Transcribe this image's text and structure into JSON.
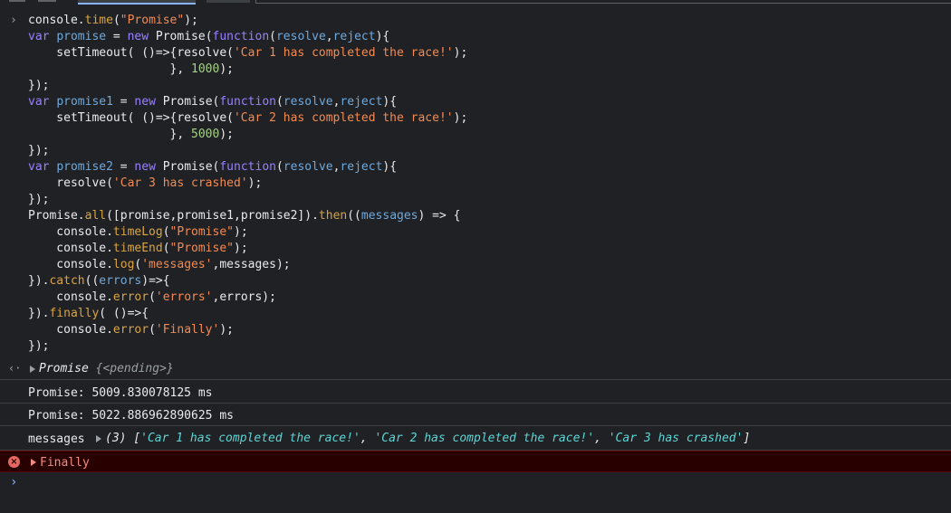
{
  "console": {
    "prompt_symbol": "›",
    "result_symbol": "‹·",
    "input_lines": [
      [
        [
          "default",
          "console."
        ],
        [
          "method",
          "time"
        ],
        [
          "default",
          "("
        ],
        [
          "string",
          "\"Promise\""
        ],
        [
          "default",
          ");"
        ]
      ],
      [
        [
          "keyword",
          "var "
        ],
        [
          "variable",
          "promise"
        ],
        [
          "default",
          " = "
        ],
        [
          "keyword",
          "new "
        ],
        [
          "default",
          "Promise("
        ],
        [
          "keyword",
          "function"
        ],
        [
          "default",
          "("
        ],
        [
          "param",
          "resolve"
        ],
        [
          "default",
          ","
        ],
        [
          "param",
          "reject"
        ],
        [
          "default",
          "){"
        ]
      ],
      [
        [
          "default",
          "    setTimeout( ()=>{resolve("
        ],
        [
          "string",
          "'Car 1 has completed the race!'"
        ],
        [
          "default",
          ");"
        ]
      ],
      [
        [
          "default",
          "                    }, "
        ],
        [
          "number",
          "1000"
        ],
        [
          "default",
          ");"
        ]
      ],
      [
        [
          "default",
          "});"
        ]
      ],
      [
        [
          "keyword",
          "var "
        ],
        [
          "variable",
          "promise1"
        ],
        [
          "default",
          " = "
        ],
        [
          "keyword",
          "new "
        ],
        [
          "default",
          "Promise("
        ],
        [
          "keyword",
          "function"
        ],
        [
          "default",
          "("
        ],
        [
          "param",
          "resolve"
        ],
        [
          "default",
          ","
        ],
        [
          "param",
          "reject"
        ],
        [
          "default",
          "){"
        ]
      ],
      [
        [
          "default",
          "    setTimeout( ()=>{resolve("
        ],
        [
          "string",
          "'Car 2 has completed the race!'"
        ],
        [
          "default",
          ");"
        ]
      ],
      [
        [
          "default",
          "                    }, "
        ],
        [
          "number",
          "5000"
        ],
        [
          "default",
          ");"
        ]
      ],
      [
        [
          "default",
          "});"
        ]
      ],
      [
        [
          "keyword",
          "var "
        ],
        [
          "variable",
          "promise2"
        ],
        [
          "default",
          " = "
        ],
        [
          "keyword",
          "new "
        ],
        [
          "default",
          "Promise("
        ],
        [
          "keyword",
          "function"
        ],
        [
          "default",
          "("
        ],
        [
          "param",
          "resolve"
        ],
        [
          "default",
          ","
        ],
        [
          "param",
          "reject"
        ],
        [
          "default",
          "){"
        ]
      ],
      [
        [
          "default",
          "    resolve("
        ],
        [
          "string",
          "'Car 3 has crashed'"
        ],
        [
          "default",
          ");"
        ]
      ],
      [
        [
          "default",
          "});"
        ]
      ],
      [
        [
          "default",
          "Promise."
        ],
        [
          "method",
          "all"
        ],
        [
          "default",
          "([promise,promise1,promise2])."
        ],
        [
          "method",
          "then"
        ],
        [
          "default",
          "(("
        ],
        [
          "param",
          "messages"
        ],
        [
          "default",
          ") => {"
        ]
      ],
      [
        [
          "default",
          "    console."
        ],
        [
          "method",
          "timeLog"
        ],
        [
          "default",
          "("
        ],
        [
          "string",
          "\"Promise\""
        ],
        [
          "default",
          ");"
        ]
      ],
      [
        [
          "default",
          "    console."
        ],
        [
          "method",
          "timeEnd"
        ],
        [
          "default",
          "("
        ],
        [
          "string",
          "\"Promise\""
        ],
        [
          "default",
          ");"
        ]
      ],
      [
        [
          "default",
          "    console."
        ],
        [
          "method",
          "log"
        ],
        [
          "default",
          "("
        ],
        [
          "string",
          "'messages'"
        ],
        [
          "default",
          ",messages);"
        ]
      ],
      [
        [
          "default",
          "})."
        ],
        [
          "method",
          "catch"
        ],
        [
          "default",
          "(("
        ],
        [
          "param",
          "errors"
        ],
        [
          "default",
          ")=>{"
        ]
      ],
      [
        [
          "default",
          "    console."
        ],
        [
          "method",
          "error"
        ],
        [
          "default",
          "("
        ],
        [
          "string",
          "'errors'"
        ],
        [
          "default",
          ",errors);"
        ]
      ],
      [
        [
          "default",
          "})."
        ],
        [
          "method",
          "finally"
        ],
        [
          "default",
          "( ()=>{"
        ]
      ],
      [
        [
          "default",
          "    console."
        ],
        [
          "method",
          "error"
        ],
        [
          "default",
          "("
        ],
        [
          "string",
          "'Finally'"
        ],
        [
          "default",
          ");"
        ]
      ],
      [
        [
          "default",
          "});"
        ]
      ]
    ],
    "result": {
      "type": "Promise",
      "state": "{<pending>}"
    },
    "logs": [
      "Promise: 5009.830078125 ms",
      "Promise: 5022.886962890625 ms"
    ],
    "messages_log": {
      "label": "messages",
      "count": "(3)",
      "open_bracket": "[",
      "items": [
        "'Car 1 has completed the race!'",
        "'Car 2 has completed the race!'",
        "'Car 3 has crashed'"
      ],
      "separator": ", ",
      "close_bracket": "]"
    },
    "error_log": {
      "icon": "×",
      "text": "Finally"
    },
    "colors": {
      "background": "#202124",
      "keyword": "#9980ff",
      "variable": "#6fa8dc",
      "string": "#f28b54",
      "number": "#a6d189",
      "method": "#d9a441",
      "array_string": "#5cd5d5",
      "error_background": "#290000",
      "error_text": "#f28b82",
      "prompt": "#8ab4f8"
    }
  }
}
